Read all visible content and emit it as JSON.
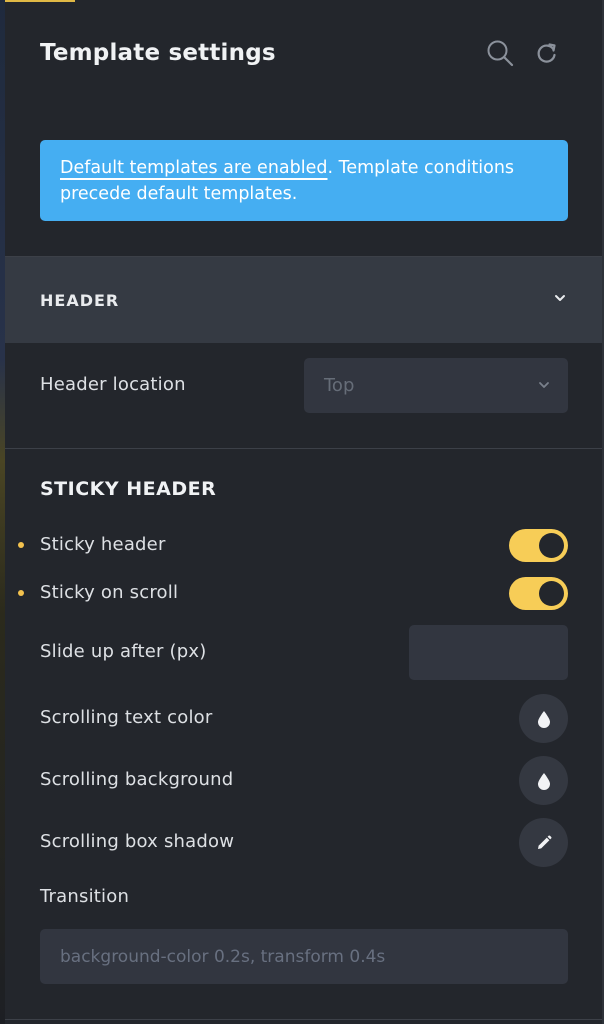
{
  "header": {
    "title": "Template settings",
    "search_icon": "search-icon",
    "reset_icon": "reset-icon"
  },
  "notice": {
    "link_text": "Default templates are enabled",
    "text": ". Template conditions precede default templates.",
    "background": "#45aef2"
  },
  "accordion": {
    "title": "HEADER",
    "expanded": true
  },
  "header_location": {
    "label": "Header location",
    "value": "Top"
  },
  "sticky": {
    "section_title": "STICKY HEADER",
    "sticky_header": {
      "label": "Sticky header",
      "enabled": true
    },
    "sticky_on_scroll": {
      "label": "Sticky on scroll",
      "enabled": true
    },
    "slide_up_after": {
      "label": "Slide up after (px)",
      "value": ""
    },
    "scrolling_text_color": {
      "label": "Scrolling text color",
      "icon": "color-drop-icon"
    },
    "scrolling_background": {
      "label": "Scrolling background",
      "icon": "color-drop-icon"
    },
    "scrolling_box_shadow": {
      "label": "Scrolling box shadow",
      "icon": "pencil-icon"
    },
    "transition": {
      "label": "Transition",
      "placeholder": "background-color 0.2s, transform 0.4s"
    }
  },
  "colors": {
    "accent": "#f7cd57",
    "panel": "#23262c",
    "info": "#45aef2"
  }
}
